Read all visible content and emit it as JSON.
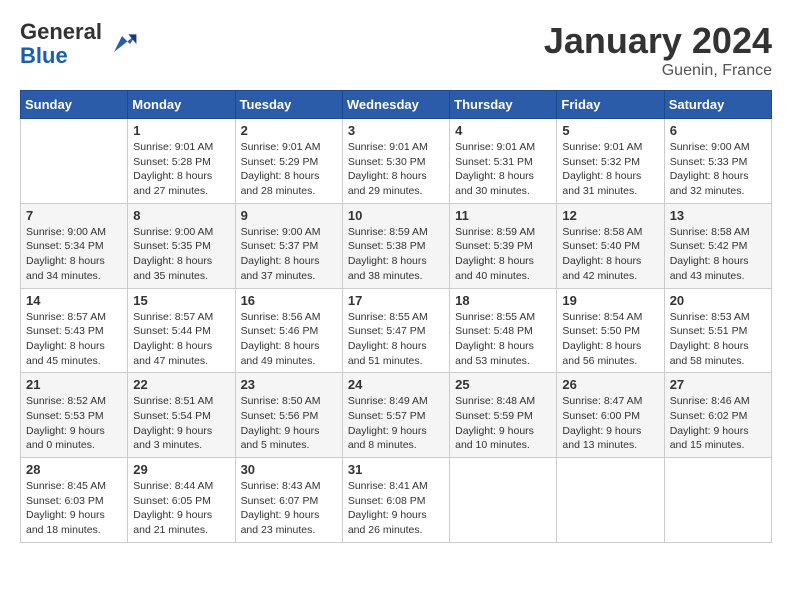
{
  "logo": {
    "general": "General",
    "blue": "Blue"
  },
  "title": "January 2024",
  "location": "Guenin, France",
  "days_of_week": [
    "Sunday",
    "Monday",
    "Tuesday",
    "Wednesday",
    "Thursday",
    "Friday",
    "Saturday"
  ],
  "weeks": [
    [
      {
        "day": "",
        "sunrise": "",
        "sunset": "",
        "daylight": ""
      },
      {
        "day": "1",
        "sunrise": "Sunrise: 9:01 AM",
        "sunset": "Sunset: 5:28 PM",
        "daylight": "Daylight: 8 hours and 27 minutes."
      },
      {
        "day": "2",
        "sunrise": "Sunrise: 9:01 AM",
        "sunset": "Sunset: 5:29 PM",
        "daylight": "Daylight: 8 hours and 28 minutes."
      },
      {
        "day": "3",
        "sunrise": "Sunrise: 9:01 AM",
        "sunset": "Sunset: 5:30 PM",
        "daylight": "Daylight: 8 hours and 29 minutes."
      },
      {
        "day": "4",
        "sunrise": "Sunrise: 9:01 AM",
        "sunset": "Sunset: 5:31 PM",
        "daylight": "Daylight: 8 hours and 30 minutes."
      },
      {
        "day": "5",
        "sunrise": "Sunrise: 9:01 AM",
        "sunset": "Sunset: 5:32 PM",
        "daylight": "Daylight: 8 hours and 31 minutes."
      },
      {
        "day": "6",
        "sunrise": "Sunrise: 9:00 AM",
        "sunset": "Sunset: 5:33 PM",
        "daylight": "Daylight: 8 hours and 32 minutes."
      }
    ],
    [
      {
        "day": "7",
        "sunrise": "Sunrise: 9:00 AM",
        "sunset": "Sunset: 5:34 PM",
        "daylight": "Daylight: 8 hours and 34 minutes."
      },
      {
        "day": "8",
        "sunrise": "Sunrise: 9:00 AM",
        "sunset": "Sunset: 5:35 PM",
        "daylight": "Daylight: 8 hours and 35 minutes."
      },
      {
        "day": "9",
        "sunrise": "Sunrise: 9:00 AM",
        "sunset": "Sunset: 5:37 PM",
        "daylight": "Daylight: 8 hours and 37 minutes."
      },
      {
        "day": "10",
        "sunrise": "Sunrise: 8:59 AM",
        "sunset": "Sunset: 5:38 PM",
        "daylight": "Daylight: 8 hours and 38 minutes."
      },
      {
        "day": "11",
        "sunrise": "Sunrise: 8:59 AM",
        "sunset": "Sunset: 5:39 PM",
        "daylight": "Daylight: 8 hours and 40 minutes."
      },
      {
        "day": "12",
        "sunrise": "Sunrise: 8:58 AM",
        "sunset": "Sunset: 5:40 PM",
        "daylight": "Daylight: 8 hours and 42 minutes."
      },
      {
        "day": "13",
        "sunrise": "Sunrise: 8:58 AM",
        "sunset": "Sunset: 5:42 PM",
        "daylight": "Daylight: 8 hours and 43 minutes."
      }
    ],
    [
      {
        "day": "14",
        "sunrise": "Sunrise: 8:57 AM",
        "sunset": "Sunset: 5:43 PM",
        "daylight": "Daylight: 8 hours and 45 minutes."
      },
      {
        "day": "15",
        "sunrise": "Sunrise: 8:57 AM",
        "sunset": "Sunset: 5:44 PM",
        "daylight": "Daylight: 8 hours and 47 minutes."
      },
      {
        "day": "16",
        "sunrise": "Sunrise: 8:56 AM",
        "sunset": "Sunset: 5:46 PM",
        "daylight": "Daylight: 8 hours and 49 minutes."
      },
      {
        "day": "17",
        "sunrise": "Sunrise: 8:55 AM",
        "sunset": "Sunset: 5:47 PM",
        "daylight": "Daylight: 8 hours and 51 minutes."
      },
      {
        "day": "18",
        "sunrise": "Sunrise: 8:55 AM",
        "sunset": "Sunset: 5:48 PM",
        "daylight": "Daylight: 8 hours and 53 minutes."
      },
      {
        "day": "19",
        "sunrise": "Sunrise: 8:54 AM",
        "sunset": "Sunset: 5:50 PM",
        "daylight": "Daylight: 8 hours and 56 minutes."
      },
      {
        "day": "20",
        "sunrise": "Sunrise: 8:53 AM",
        "sunset": "Sunset: 5:51 PM",
        "daylight": "Daylight: 8 hours and 58 minutes."
      }
    ],
    [
      {
        "day": "21",
        "sunrise": "Sunrise: 8:52 AM",
        "sunset": "Sunset: 5:53 PM",
        "daylight": "Daylight: 9 hours and 0 minutes."
      },
      {
        "day": "22",
        "sunrise": "Sunrise: 8:51 AM",
        "sunset": "Sunset: 5:54 PM",
        "daylight": "Daylight: 9 hours and 3 minutes."
      },
      {
        "day": "23",
        "sunrise": "Sunrise: 8:50 AM",
        "sunset": "Sunset: 5:56 PM",
        "daylight": "Daylight: 9 hours and 5 minutes."
      },
      {
        "day": "24",
        "sunrise": "Sunrise: 8:49 AM",
        "sunset": "Sunset: 5:57 PM",
        "daylight": "Daylight: 9 hours and 8 minutes."
      },
      {
        "day": "25",
        "sunrise": "Sunrise: 8:48 AM",
        "sunset": "Sunset: 5:59 PM",
        "daylight": "Daylight: 9 hours and 10 minutes."
      },
      {
        "day": "26",
        "sunrise": "Sunrise: 8:47 AM",
        "sunset": "Sunset: 6:00 PM",
        "daylight": "Daylight: 9 hours and 13 minutes."
      },
      {
        "day": "27",
        "sunrise": "Sunrise: 8:46 AM",
        "sunset": "Sunset: 6:02 PM",
        "daylight": "Daylight: 9 hours and 15 minutes."
      }
    ],
    [
      {
        "day": "28",
        "sunrise": "Sunrise: 8:45 AM",
        "sunset": "Sunset: 6:03 PM",
        "daylight": "Daylight: 9 hours and 18 minutes."
      },
      {
        "day": "29",
        "sunrise": "Sunrise: 8:44 AM",
        "sunset": "Sunset: 6:05 PM",
        "daylight": "Daylight: 9 hours and 21 minutes."
      },
      {
        "day": "30",
        "sunrise": "Sunrise: 8:43 AM",
        "sunset": "Sunset: 6:07 PM",
        "daylight": "Daylight: 9 hours and 23 minutes."
      },
      {
        "day": "31",
        "sunrise": "Sunrise: 8:41 AM",
        "sunset": "Sunset: 6:08 PM",
        "daylight": "Daylight: 9 hours and 26 minutes."
      },
      {
        "day": "",
        "sunrise": "",
        "sunset": "",
        "daylight": ""
      },
      {
        "day": "",
        "sunrise": "",
        "sunset": "",
        "daylight": ""
      },
      {
        "day": "",
        "sunrise": "",
        "sunset": "",
        "daylight": ""
      }
    ]
  ]
}
